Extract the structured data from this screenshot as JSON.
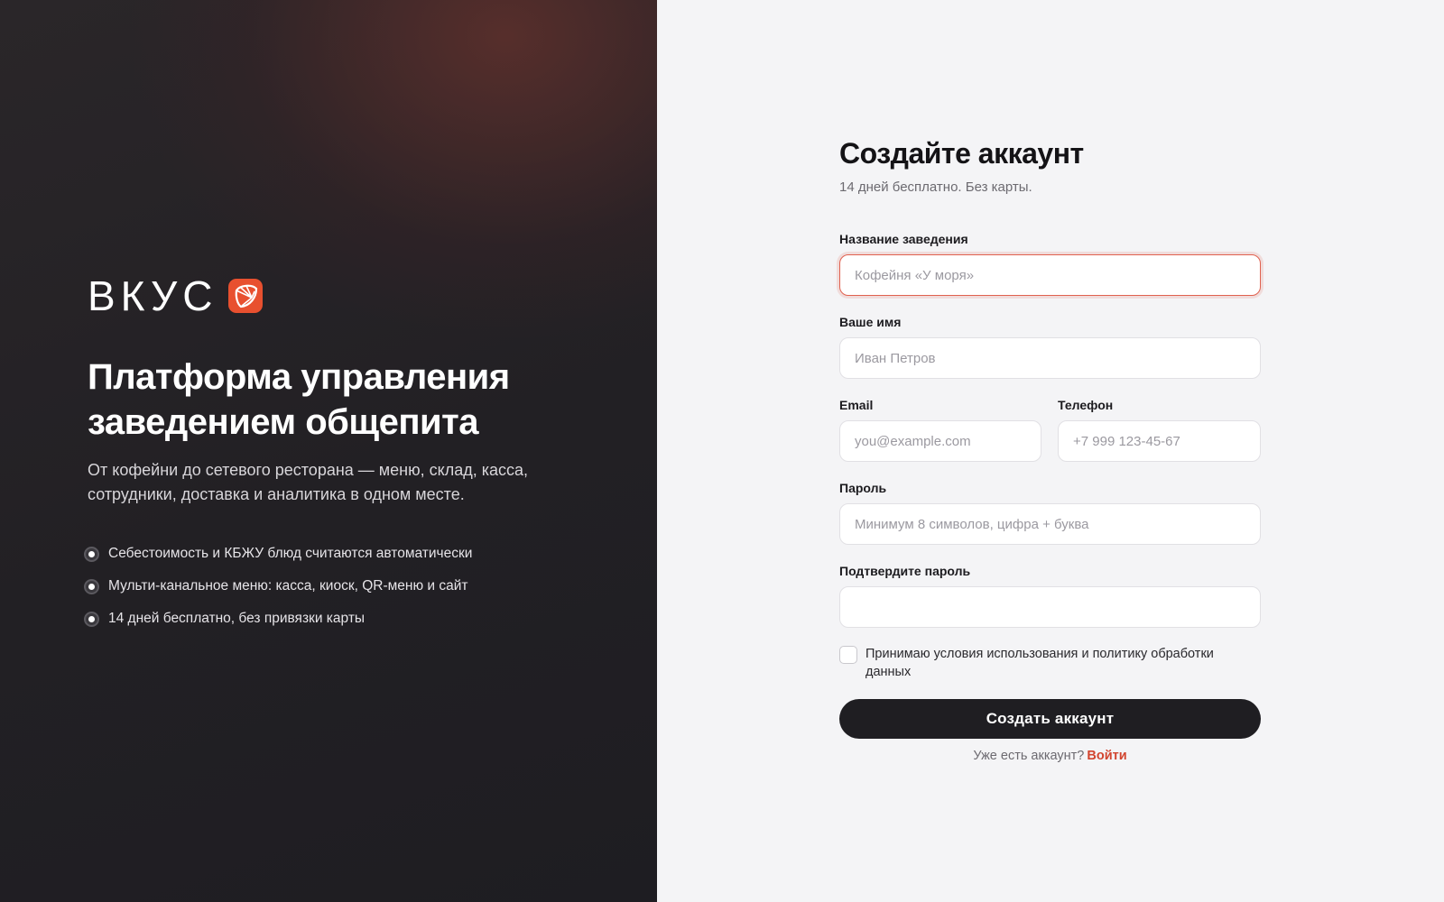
{
  "brand": {
    "name": "ВКУС",
    "accent": "#e8502f"
  },
  "hero": {
    "headline": "Платформа управления заведением общепита",
    "lead": "От кофейни до сетевого ресторана — меню, склад, касса, сотрудники, доставка и аналитика в одном месте.",
    "features": [
      "Себестоимость и КБЖУ блюд считаются автоматически",
      "Мульти-канальное меню: касса, киоск, QR-меню и сайт",
      "14 дней бесплатно, без привязки карты"
    ]
  },
  "form": {
    "title": "Создайте аккаунт",
    "subtitle": "14 дней бесплатно. Без карты.",
    "venue": {
      "label": "Название заведения",
      "placeholder": "Кофейня «У моря»",
      "value": ""
    },
    "name": {
      "label": "Ваше имя",
      "placeholder": "Иван Петров",
      "value": ""
    },
    "email": {
      "label": "Email",
      "placeholder": "you@example.com",
      "value": ""
    },
    "phone": {
      "label": "Телефон",
      "placeholder": "+7 999 123-45-67",
      "value": ""
    },
    "password": {
      "label": "Пароль",
      "placeholder": "Минимум 8 символов, цифра + буква",
      "value": ""
    },
    "confirm": {
      "label": "Подтвердите пароль",
      "placeholder": "",
      "value": ""
    },
    "terms": "Принимаю условия использования и политику обработки данных",
    "submit": "Создать аккаунт",
    "login_prompt": "Уже есть аккаунт?",
    "login_link": "Войти"
  }
}
